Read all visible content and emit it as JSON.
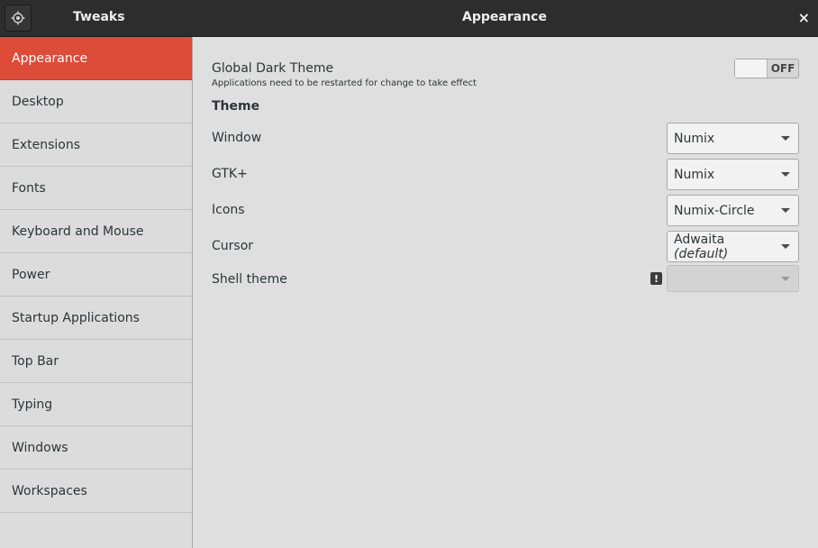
{
  "titlebar": {
    "app_title": "Tweaks",
    "window_title": "Appearance",
    "close_glyph": "×",
    "menu_icon": "target-icon"
  },
  "sidebar": {
    "items": [
      {
        "label": "Appearance",
        "active": true
      },
      {
        "label": "Desktop"
      },
      {
        "label": "Extensions"
      },
      {
        "label": "Fonts"
      },
      {
        "label": "Keyboard and Mouse"
      },
      {
        "label": "Power"
      },
      {
        "label": "Startup Applications"
      },
      {
        "label": "Top Bar"
      },
      {
        "label": "Typing"
      },
      {
        "label": "Windows"
      },
      {
        "label": "Workspaces"
      }
    ]
  },
  "appearance": {
    "dark_theme": {
      "label": "Global Dark Theme",
      "subtitle": "Applications need to be restarted for change to take effect",
      "state": "OFF"
    },
    "theme_header": "Theme",
    "rows": {
      "window": {
        "label": "Window",
        "value": "Numix"
      },
      "gtk": {
        "label": "GTK+",
        "value": "Numix"
      },
      "icons": {
        "label": "Icons",
        "value": "Numix-Circle"
      },
      "cursor": {
        "label": "Cursor",
        "value": "Adwaita",
        "value_suffix": "(default)"
      },
      "shell": {
        "label": "Shell theme",
        "value": "",
        "warning_glyph": "!",
        "warning_icon": "exclamation-icon"
      }
    }
  },
  "colors": {
    "accent": "#dd4b39",
    "titlebar": "#2d2d2d",
    "background": "#dfdfdf"
  }
}
